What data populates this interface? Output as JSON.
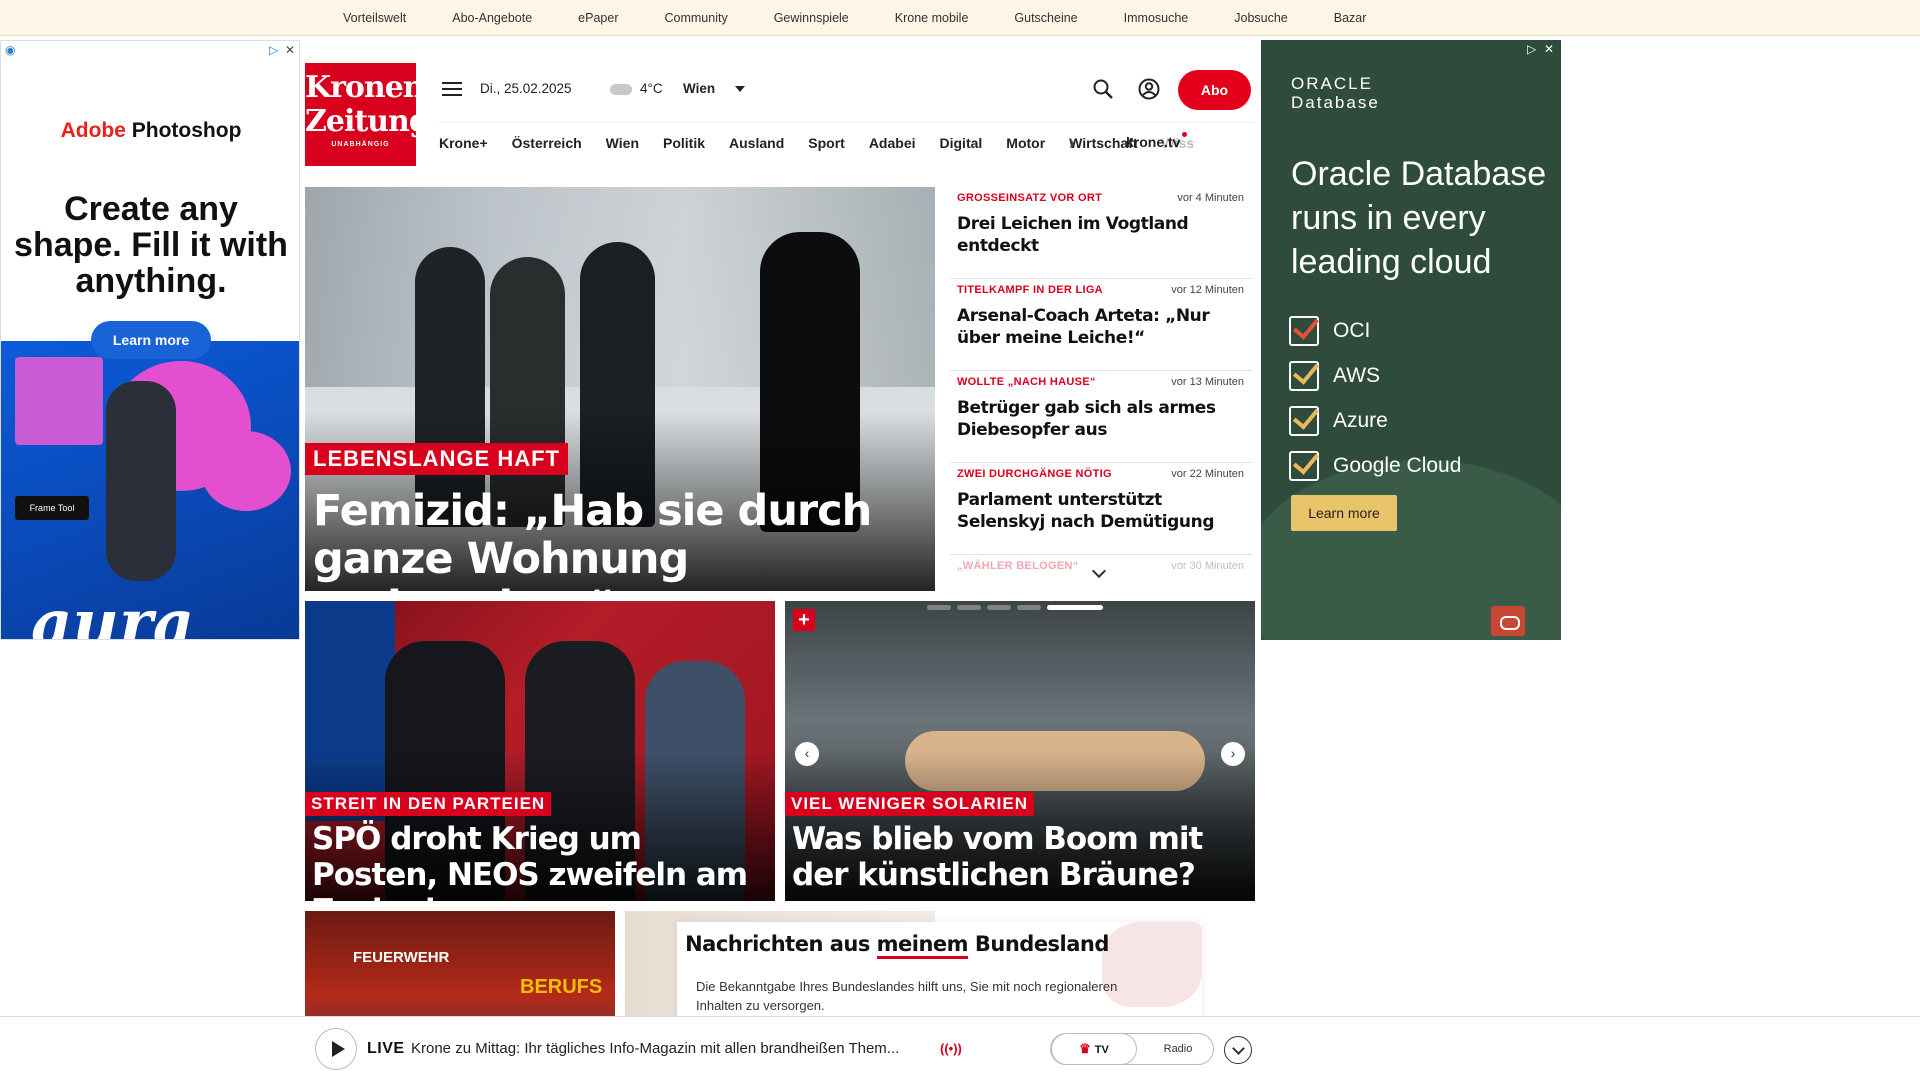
{
  "topbar": {
    "links": [
      "Vorteilswelt",
      "Abo-Angebote",
      "ePaper",
      "Community",
      "Gewinnspiele",
      "Krone mobile",
      "Gutscheine",
      "Immosuche",
      "Jobsuche",
      "Bazar"
    ]
  },
  "ad_left": {
    "brand_adobe": "Adobe",
    "brand_product": "Photoshop",
    "headline": "Create any shape. Fill it with anything.",
    "cta": "Learn more",
    "frame_label": "Frame Tool",
    "art_word": "aura"
  },
  "ad_right": {
    "logo_line1": "ORACLE",
    "logo_line2": "Database",
    "headline": "Oracle Database runs in every leading cloud",
    "items": [
      "OCI",
      "AWS",
      "Azure",
      "Google Cloud"
    ],
    "cta": "Learn more"
  },
  "header": {
    "logo_line1": "Kronen",
    "logo_line2": "Zeitung",
    "logo_line3": "UNABHÄNGIG",
    "date": "Di., 25.02.2025",
    "temperature": "4°C",
    "city": "Wien",
    "abo_label": "Abo",
    "nav": [
      "Krone+",
      "Österreich",
      "Wien",
      "Politik",
      "Ausland",
      "Sport",
      "Adabei",
      "Digital",
      "Motor",
      "Wirtschaft"
    ],
    "nav_faded": "Wiss",
    "nav_tv": "krone.tv"
  },
  "hero": {
    "kicker": "LEBENSLANGE HAFT",
    "title": "Femizid: „Hab sie durch ganze Wohnung gedroschen“"
  },
  "ticker": [
    {
      "kicker": "GROSSEINSATZ VOR ORT",
      "time": "vor 4 Minuten",
      "title": "Drei Leichen im Vogtland entdeckt"
    },
    {
      "kicker": "TITELKAMPF IN DER LIGA",
      "time": "vor 12 Minuten",
      "title": "Arsenal-Coach Arteta: „Nur über meine Leiche!“"
    },
    {
      "kicker": "WOLLTE „NACH HAUSE“",
      "time": "vor 13 Minuten",
      "title": "Betrüger gab sich als armes Diebesopfer aus"
    },
    {
      "kicker": "ZWEI DURCHGÄNGE NÖTIG",
      "time": "vor 22 Minuten",
      "title": "Parlament unterstützt Selenskyj nach Demütigung"
    },
    {
      "kicker": "„WÄHLER BELOGEN“",
      "time": "vor 30 Minuten",
      "title": ""
    }
  ],
  "card1": {
    "kicker": "STREIT IN DEN PARTEIEN",
    "title": "SPÖ droht Krieg um Posten, NEOS zweifeln am Zuckerl"
  },
  "card2": {
    "kicker": "VIEL WENIGER SOLARIEN",
    "title": "Was blieb vom Boom mit der künstlichen Bräune?",
    "plus": "+",
    "prev": "‹",
    "next": "›"
  },
  "bottom": {
    "fw_label": "FEUERWEHR",
    "berufs_label": "BERUFS"
  },
  "bundesland": {
    "title_pre": "Nachrichten aus ",
    "title_underlined": "meinem",
    "title_post": " Bundesland",
    "text": "Die Bekanntgabe Ihres Bundeslandes hilft uns, Sie mit noch regionaleren Inhalten zu versorgen."
  },
  "player": {
    "live": "LIVE",
    "title": "Krone zu Mittag: Ihr tägliches Info-Magazin mit allen brandheißen Them...",
    "radio_icon": "((•))",
    "tv_label": "TV",
    "radio_label": "Radio"
  }
}
